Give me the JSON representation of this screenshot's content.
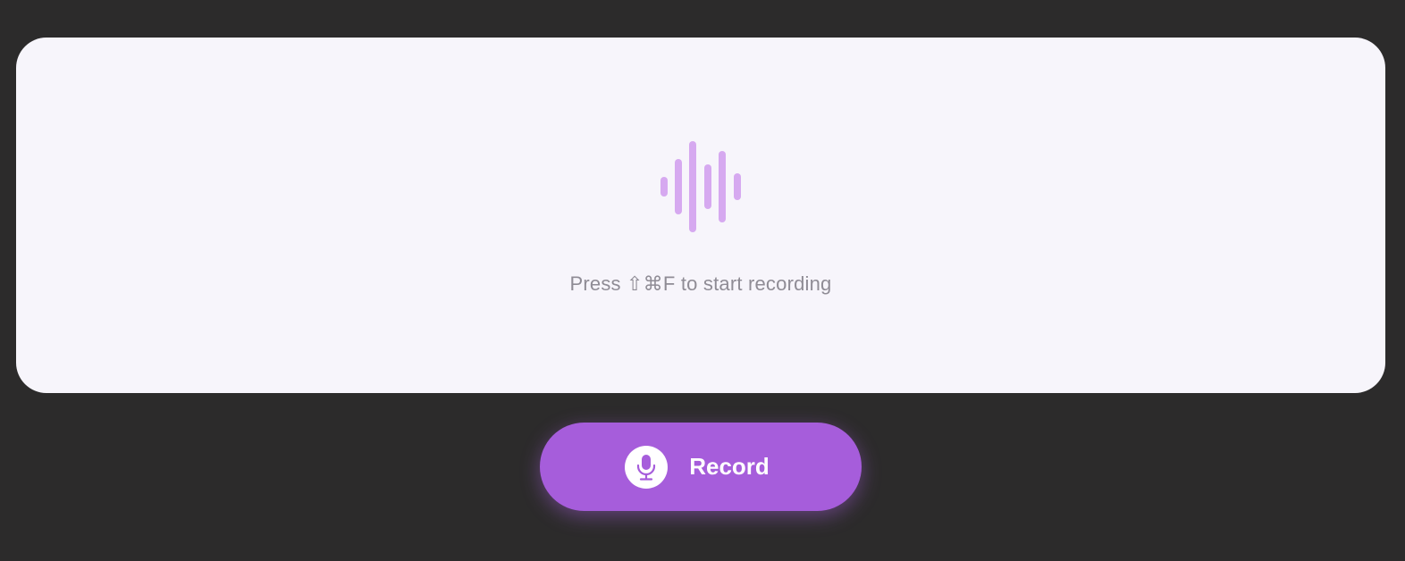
{
  "panel": {
    "hint_text": "Press ⇧⌘F to start recording",
    "wave_icon": "waveform-icon",
    "wave_color": "#d6a9f0"
  },
  "record_button": {
    "label": "Record",
    "icon": "microphone-icon",
    "color": "#a65ddb"
  },
  "colors": {
    "background": "#2c2b2b",
    "panel": "#f7f5fb",
    "hint": "#8f8c95"
  }
}
